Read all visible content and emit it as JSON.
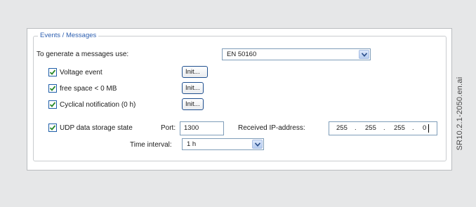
{
  "group": {
    "title": "Events / Messages"
  },
  "messages_use": {
    "label": "To generate a messages use:",
    "selected": "EN 50160"
  },
  "events": [
    {
      "label": "Voltage event",
      "checked": true,
      "button": "Init..."
    },
    {
      "label": "free space < 0 MB",
      "checked": true,
      "button": "Init..."
    },
    {
      "label": "Cyclical notification (0 h)",
      "checked": true,
      "button": "Init..."
    }
  ],
  "udp": {
    "label": "UDP data storage state",
    "checked": true,
    "port_label": "Port:",
    "port_value": "1300",
    "ip_label": "Received IP-address:",
    "ip_parts": [
      "255",
      "255",
      "255",
      "0"
    ],
    "ip_separator": "."
  },
  "interval": {
    "label": "Time interval:",
    "selected": "1 h"
  },
  "side_caption": "SR10.2.1-2050.en.ai",
  "colors": {
    "accent": "#2d5fb0",
    "check": "#2a8a2a",
    "background": "#e6e7e8"
  }
}
